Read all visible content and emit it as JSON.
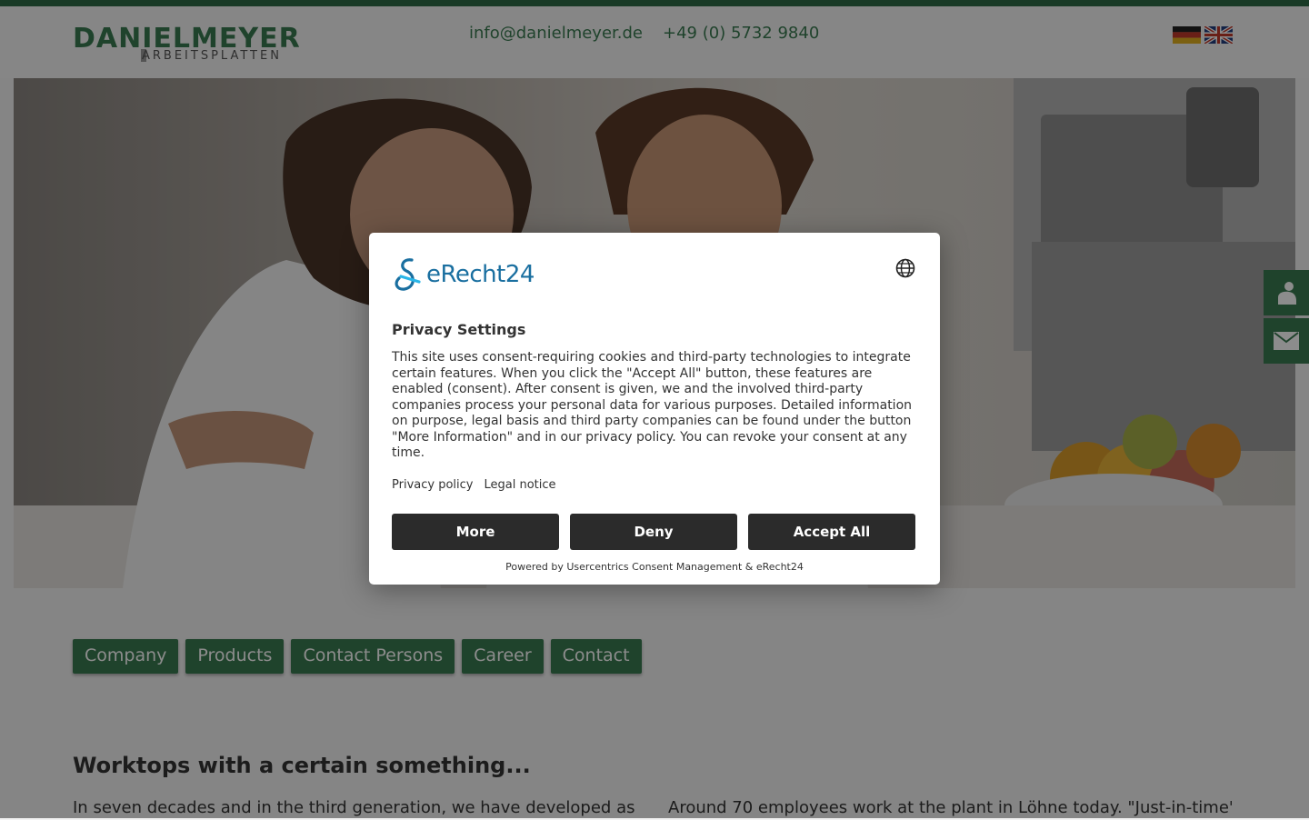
{
  "header": {
    "logo_main": "DANIELMEYER",
    "logo_sub": "ARBEITSPLATTEN",
    "email": "info@danielmeyer.de",
    "phone": "+49 (0) 5732 9840",
    "flags": [
      "german-flag-icon",
      "uk-flag-icon"
    ]
  },
  "side_buttons": [
    "contact-person-icon",
    "mail-icon"
  ],
  "nav": {
    "items": [
      "Company",
      "Products",
      "Contact Persons",
      "Career",
      "Contact"
    ]
  },
  "content": {
    "headline": "Worktops with a certain something...",
    "col1": "In seven decades and in the third generation, we have developed as a",
    "col2": "Around 70 employees work at the plant in Löhne today. \"Just-in-time\""
  },
  "consent": {
    "brand": "eRecht24",
    "title": "Privacy Settings",
    "body": "This site uses consent-requiring cookies and third-party technologies to integrate certain features. When you click the \"Accept All\" button, these features are enabled (consent). After consent is given, we and the involved third-party companies process your personal data for various purposes. Detailed information on purpose, legal basis and third party companies can be found under the button \"More Information\" and in our privacy policy. You can revoke your consent at any time.",
    "privacy_link": "Privacy policy",
    "legal_link": "Legal notice",
    "more": "More",
    "deny": "Deny",
    "accept": "Accept All",
    "powered": "Powered by Usercentrics Consent Management & eRecht24"
  },
  "colors": {
    "brand_green": "#3a7a50",
    "dark_button": "#2b2b2b",
    "erecht_blue": "#1a6fa0"
  }
}
